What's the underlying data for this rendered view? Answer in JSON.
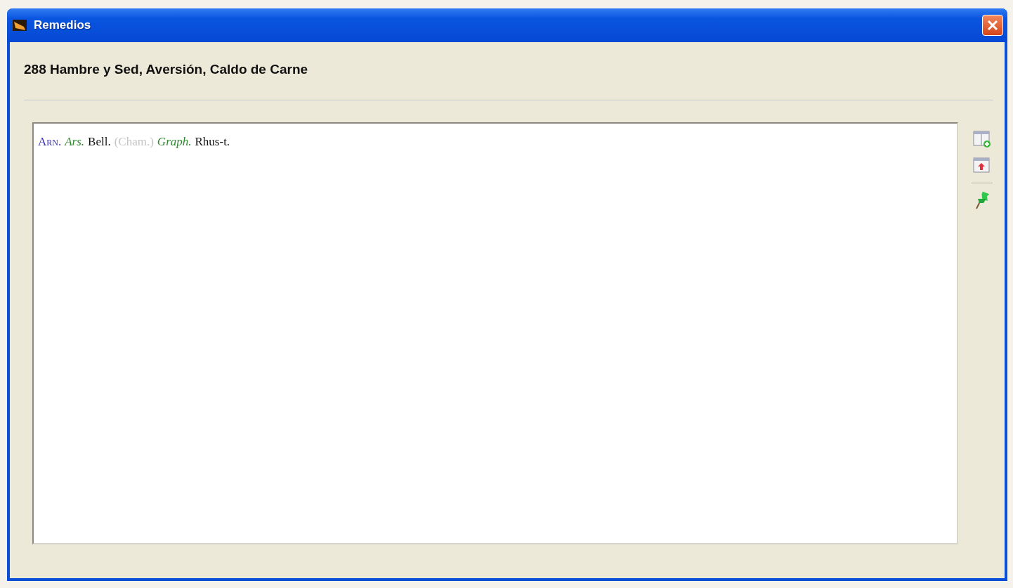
{
  "window": {
    "title": "Remedios"
  },
  "heading": "288 Hambre y Sed, Aversión, Caldo de Carne",
  "remedies": [
    {
      "text": "Arn.",
      "kind": "caps"
    },
    {
      "text": "Ars.",
      "kind": "italic"
    },
    {
      "text": "Bell.",
      "kind": "plain"
    },
    {
      "text": "(Cham.)",
      "kind": "faded"
    },
    {
      "text": "Graph.",
      "kind": "italic"
    },
    {
      "text": "Rhus-t.",
      "kind": "plain"
    }
  ]
}
